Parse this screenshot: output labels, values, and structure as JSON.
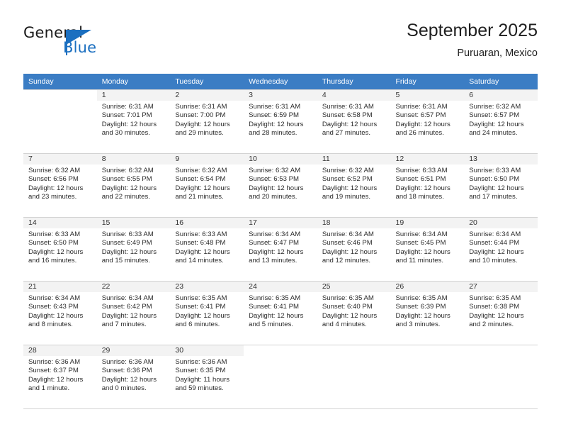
{
  "brand": {
    "name_part1": "General",
    "name_part2": "Blue",
    "accent_color": "#1b6fc0"
  },
  "header": {
    "title": "September 2025",
    "subtitle": "Puruaran, Mexico"
  },
  "calendar": {
    "header_bg": "#3b7dc4",
    "daynum_bg": "#f3f3f3",
    "weekday_labels": [
      "Sunday",
      "Monday",
      "Tuesday",
      "Wednesday",
      "Thursday",
      "Friday",
      "Saturday"
    ],
    "weeks": [
      [
        {
          "day": "",
          "sunrise": "",
          "sunset": "",
          "daylight": "",
          "daylight2": ""
        },
        {
          "day": "1",
          "sunrise": "Sunrise: 6:31 AM",
          "sunset": "Sunset: 7:01 PM",
          "daylight": "Daylight: 12 hours",
          "daylight2": "and 30 minutes."
        },
        {
          "day": "2",
          "sunrise": "Sunrise: 6:31 AM",
          "sunset": "Sunset: 7:00 PM",
          "daylight": "Daylight: 12 hours",
          "daylight2": "and 29 minutes."
        },
        {
          "day": "3",
          "sunrise": "Sunrise: 6:31 AM",
          "sunset": "Sunset: 6:59 PM",
          "daylight": "Daylight: 12 hours",
          "daylight2": "and 28 minutes."
        },
        {
          "day": "4",
          "sunrise": "Sunrise: 6:31 AM",
          "sunset": "Sunset: 6:58 PM",
          "daylight": "Daylight: 12 hours",
          "daylight2": "and 27 minutes."
        },
        {
          "day": "5",
          "sunrise": "Sunrise: 6:31 AM",
          "sunset": "Sunset: 6:57 PM",
          "daylight": "Daylight: 12 hours",
          "daylight2": "and 26 minutes."
        },
        {
          "day": "6",
          "sunrise": "Sunrise: 6:32 AM",
          "sunset": "Sunset: 6:57 PM",
          "daylight": "Daylight: 12 hours",
          "daylight2": "and 24 minutes."
        }
      ],
      [
        {
          "day": "7",
          "sunrise": "Sunrise: 6:32 AM",
          "sunset": "Sunset: 6:56 PM",
          "daylight": "Daylight: 12 hours",
          "daylight2": "and 23 minutes."
        },
        {
          "day": "8",
          "sunrise": "Sunrise: 6:32 AM",
          "sunset": "Sunset: 6:55 PM",
          "daylight": "Daylight: 12 hours",
          "daylight2": "and 22 minutes."
        },
        {
          "day": "9",
          "sunrise": "Sunrise: 6:32 AM",
          "sunset": "Sunset: 6:54 PM",
          "daylight": "Daylight: 12 hours",
          "daylight2": "and 21 minutes."
        },
        {
          "day": "10",
          "sunrise": "Sunrise: 6:32 AM",
          "sunset": "Sunset: 6:53 PM",
          "daylight": "Daylight: 12 hours",
          "daylight2": "and 20 minutes."
        },
        {
          "day": "11",
          "sunrise": "Sunrise: 6:32 AM",
          "sunset": "Sunset: 6:52 PM",
          "daylight": "Daylight: 12 hours",
          "daylight2": "and 19 minutes."
        },
        {
          "day": "12",
          "sunrise": "Sunrise: 6:33 AM",
          "sunset": "Sunset: 6:51 PM",
          "daylight": "Daylight: 12 hours",
          "daylight2": "and 18 minutes."
        },
        {
          "day": "13",
          "sunrise": "Sunrise: 6:33 AM",
          "sunset": "Sunset: 6:50 PM",
          "daylight": "Daylight: 12 hours",
          "daylight2": "and 17 minutes."
        }
      ],
      [
        {
          "day": "14",
          "sunrise": "Sunrise: 6:33 AM",
          "sunset": "Sunset: 6:50 PM",
          "daylight": "Daylight: 12 hours",
          "daylight2": "and 16 minutes."
        },
        {
          "day": "15",
          "sunrise": "Sunrise: 6:33 AM",
          "sunset": "Sunset: 6:49 PM",
          "daylight": "Daylight: 12 hours",
          "daylight2": "and 15 minutes."
        },
        {
          "day": "16",
          "sunrise": "Sunrise: 6:33 AM",
          "sunset": "Sunset: 6:48 PM",
          "daylight": "Daylight: 12 hours",
          "daylight2": "and 14 minutes."
        },
        {
          "day": "17",
          "sunrise": "Sunrise: 6:34 AM",
          "sunset": "Sunset: 6:47 PM",
          "daylight": "Daylight: 12 hours",
          "daylight2": "and 13 minutes."
        },
        {
          "day": "18",
          "sunrise": "Sunrise: 6:34 AM",
          "sunset": "Sunset: 6:46 PM",
          "daylight": "Daylight: 12 hours",
          "daylight2": "and 12 minutes."
        },
        {
          "day": "19",
          "sunrise": "Sunrise: 6:34 AM",
          "sunset": "Sunset: 6:45 PM",
          "daylight": "Daylight: 12 hours",
          "daylight2": "and 11 minutes."
        },
        {
          "day": "20",
          "sunrise": "Sunrise: 6:34 AM",
          "sunset": "Sunset: 6:44 PM",
          "daylight": "Daylight: 12 hours",
          "daylight2": "and 10 minutes."
        }
      ],
      [
        {
          "day": "21",
          "sunrise": "Sunrise: 6:34 AM",
          "sunset": "Sunset: 6:43 PM",
          "daylight": "Daylight: 12 hours",
          "daylight2": "and 8 minutes."
        },
        {
          "day": "22",
          "sunrise": "Sunrise: 6:34 AM",
          "sunset": "Sunset: 6:42 PM",
          "daylight": "Daylight: 12 hours",
          "daylight2": "and 7 minutes."
        },
        {
          "day": "23",
          "sunrise": "Sunrise: 6:35 AM",
          "sunset": "Sunset: 6:41 PM",
          "daylight": "Daylight: 12 hours",
          "daylight2": "and 6 minutes."
        },
        {
          "day": "24",
          "sunrise": "Sunrise: 6:35 AM",
          "sunset": "Sunset: 6:41 PM",
          "daylight": "Daylight: 12 hours",
          "daylight2": "and 5 minutes."
        },
        {
          "day": "25",
          "sunrise": "Sunrise: 6:35 AM",
          "sunset": "Sunset: 6:40 PM",
          "daylight": "Daylight: 12 hours",
          "daylight2": "and 4 minutes."
        },
        {
          "day": "26",
          "sunrise": "Sunrise: 6:35 AM",
          "sunset": "Sunset: 6:39 PM",
          "daylight": "Daylight: 12 hours",
          "daylight2": "and 3 minutes."
        },
        {
          "day": "27",
          "sunrise": "Sunrise: 6:35 AM",
          "sunset": "Sunset: 6:38 PM",
          "daylight": "Daylight: 12 hours",
          "daylight2": "and 2 minutes."
        }
      ],
      [
        {
          "day": "28",
          "sunrise": "Sunrise: 6:36 AM",
          "sunset": "Sunset: 6:37 PM",
          "daylight": "Daylight: 12 hours",
          "daylight2": "and 1 minute."
        },
        {
          "day": "29",
          "sunrise": "Sunrise: 6:36 AM",
          "sunset": "Sunset: 6:36 PM",
          "daylight": "Daylight: 12 hours",
          "daylight2": "and 0 minutes."
        },
        {
          "day": "30",
          "sunrise": "Sunrise: 6:36 AM",
          "sunset": "Sunset: 6:35 PM",
          "daylight": "Daylight: 11 hours",
          "daylight2": "and 59 minutes."
        },
        {
          "day": "",
          "sunrise": "",
          "sunset": "",
          "daylight": "",
          "daylight2": ""
        },
        {
          "day": "",
          "sunrise": "",
          "sunset": "",
          "daylight": "",
          "daylight2": ""
        },
        {
          "day": "",
          "sunrise": "",
          "sunset": "",
          "daylight": "",
          "daylight2": ""
        },
        {
          "day": "",
          "sunrise": "",
          "sunset": "",
          "daylight": "",
          "daylight2": ""
        }
      ]
    ]
  }
}
